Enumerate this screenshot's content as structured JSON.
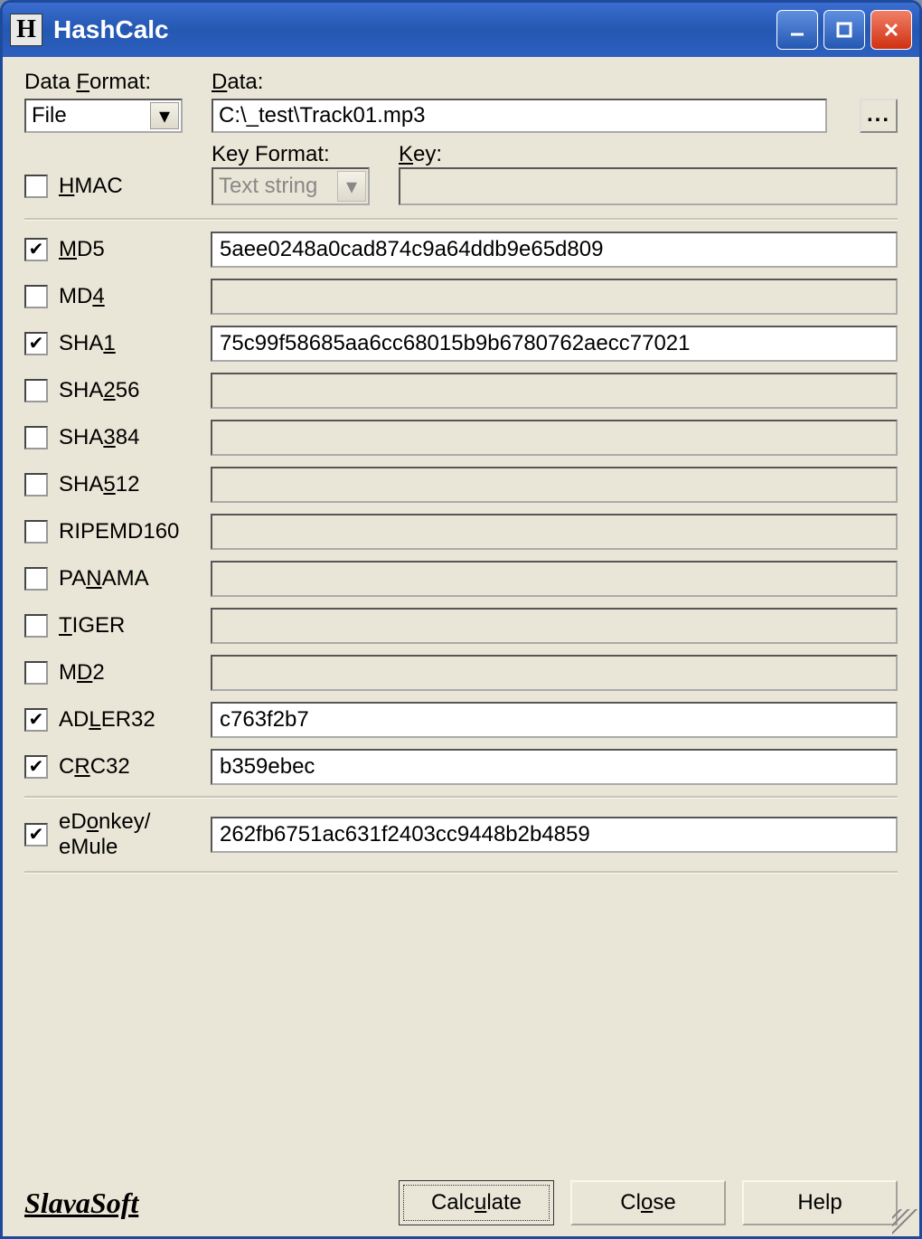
{
  "title": "HashCalc",
  "labels": {
    "data_format": "Data Format:",
    "data": "Data:",
    "hmac": "HMAC",
    "key_format": "Key Format:",
    "key": "Key:"
  },
  "data_format_value": "File",
  "data_path": "C:\\_test\\Track01.mp3",
  "key_format_value": "Text string",
  "key_value": "",
  "hmac_checked": false,
  "hashes": [
    {
      "name": "MD5",
      "checked": true,
      "value": "5aee0248a0cad874c9a64ddb9e65d809",
      "u": "M"
    },
    {
      "name": "MD4",
      "checked": false,
      "value": "",
      "u": "4"
    },
    {
      "name": "SHA1",
      "checked": true,
      "value": "75c99f58685aa6cc68015b9b6780762aecc77021",
      "u": "1"
    },
    {
      "name": "SHA256",
      "checked": false,
      "value": "",
      "u": "2"
    },
    {
      "name": "SHA384",
      "checked": false,
      "value": "",
      "u": "3"
    },
    {
      "name": "SHA512",
      "checked": false,
      "value": "",
      "u": "5"
    },
    {
      "name": "RIPEMD160",
      "checked": false,
      "value": "",
      "u": ""
    },
    {
      "name": "PANAMA",
      "checked": false,
      "value": "",
      "u": "N"
    },
    {
      "name": "TIGER",
      "checked": false,
      "value": "",
      "u": "T"
    },
    {
      "name": "MD2",
      "checked": false,
      "value": "",
      "u": "D"
    },
    {
      "name": "ADLER32",
      "checked": true,
      "value": "c763f2b7",
      "u": "L"
    },
    {
      "name": "CRC32",
      "checked": true,
      "value": "b359ebec",
      "u": "R"
    }
  ],
  "edonkey": {
    "name": "eDonkey/\neMule",
    "checked": true,
    "value": "262fb6751ac631f2403cc9448b2b4859"
  },
  "brand": "SlavaSoft",
  "buttons": {
    "calculate": "Calculate",
    "close": "Close",
    "help": "Help"
  },
  "browse_label": "..."
}
